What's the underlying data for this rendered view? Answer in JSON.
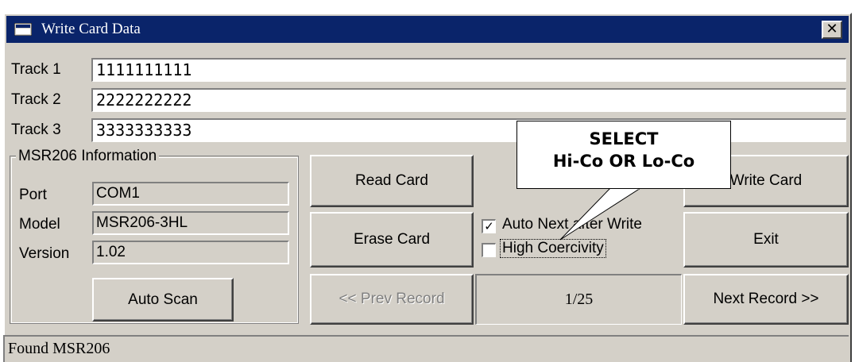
{
  "window": {
    "title": "Write Card Data",
    "close_symbol": "✕"
  },
  "tracks": [
    {
      "label": "Track 1",
      "value": "1111111111"
    },
    {
      "label": "Track 2",
      "value": "2222222222"
    },
    {
      "label": "Track 3",
      "value": "3333333333"
    }
  ],
  "info": {
    "group_label": "MSR206 Information",
    "port_label": "Port",
    "port_value": "COM1",
    "model_label": "Model",
    "model_value": "MSR206-3HL",
    "version_label": "Version",
    "version_value": "1.02",
    "auto_scan": "Auto Scan"
  },
  "buttons": {
    "read_card": "Read Card",
    "erase_card": "Erase Card",
    "prev_record": "<< Prev Record",
    "write_card": "Write Card",
    "exit": "Exit",
    "next_record": "Next Record >>"
  },
  "checkboxes": {
    "auto_next": {
      "label": "Auto Next after Write",
      "checked": true,
      "mark": "✓"
    },
    "high_coercivity": {
      "label": "High Coercivity",
      "checked": false
    }
  },
  "record_counter": "1/25",
  "status": "Found MSR206",
  "callout": {
    "line1": "SELECT",
    "line2": "Hi-Co OR Lo-Co"
  }
}
